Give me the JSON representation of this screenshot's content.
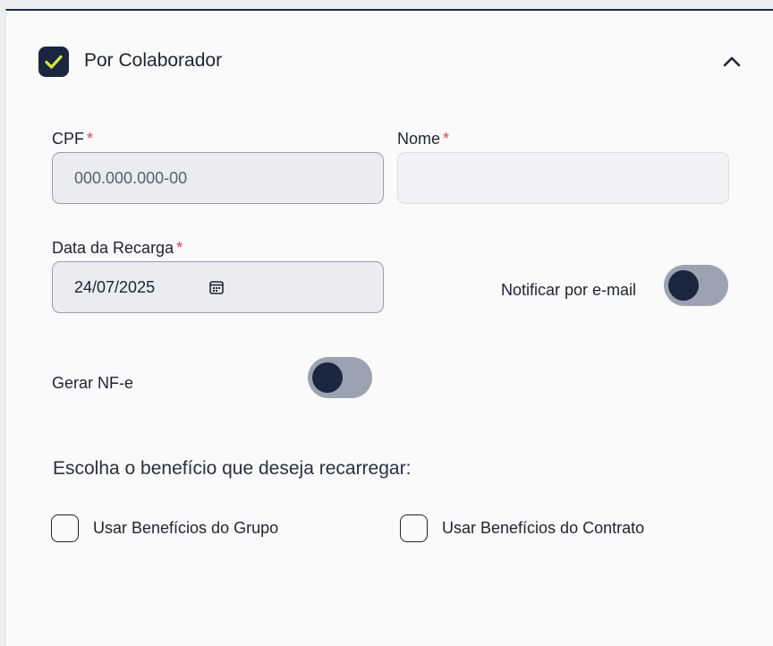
{
  "section": {
    "title": "Por Colaborador",
    "checked": true,
    "collapse_icon": "chevron-up-icon"
  },
  "cpf": {
    "label": "CPF",
    "required_mark": "*",
    "placeholder": "000.000.000-00"
  },
  "nome": {
    "label": "Nome",
    "required_mark": "*",
    "value": ""
  },
  "data_recarga": {
    "label": "Data da Recarga",
    "required_mark": "*",
    "value": "24/07/2025",
    "icon": "calendar-icon"
  },
  "notificar": {
    "label": "Notificar por e-mail",
    "on": false
  },
  "gerar_nfe": {
    "label": "Gerar NF-e",
    "on": false
  },
  "beneficio": {
    "prompt": "Escolha o benefício que deseja recarregar:",
    "options": [
      {
        "label": "Usar Benefícios do Grupo",
        "checked": false
      },
      {
        "label": "Usar Benefícios do Contrato",
        "checked": false
      }
    ]
  },
  "colors": {
    "primary": "#1b2740",
    "required": "#e0443c",
    "check": "#d4e83a",
    "toggle_track": "#9ba2b1"
  }
}
